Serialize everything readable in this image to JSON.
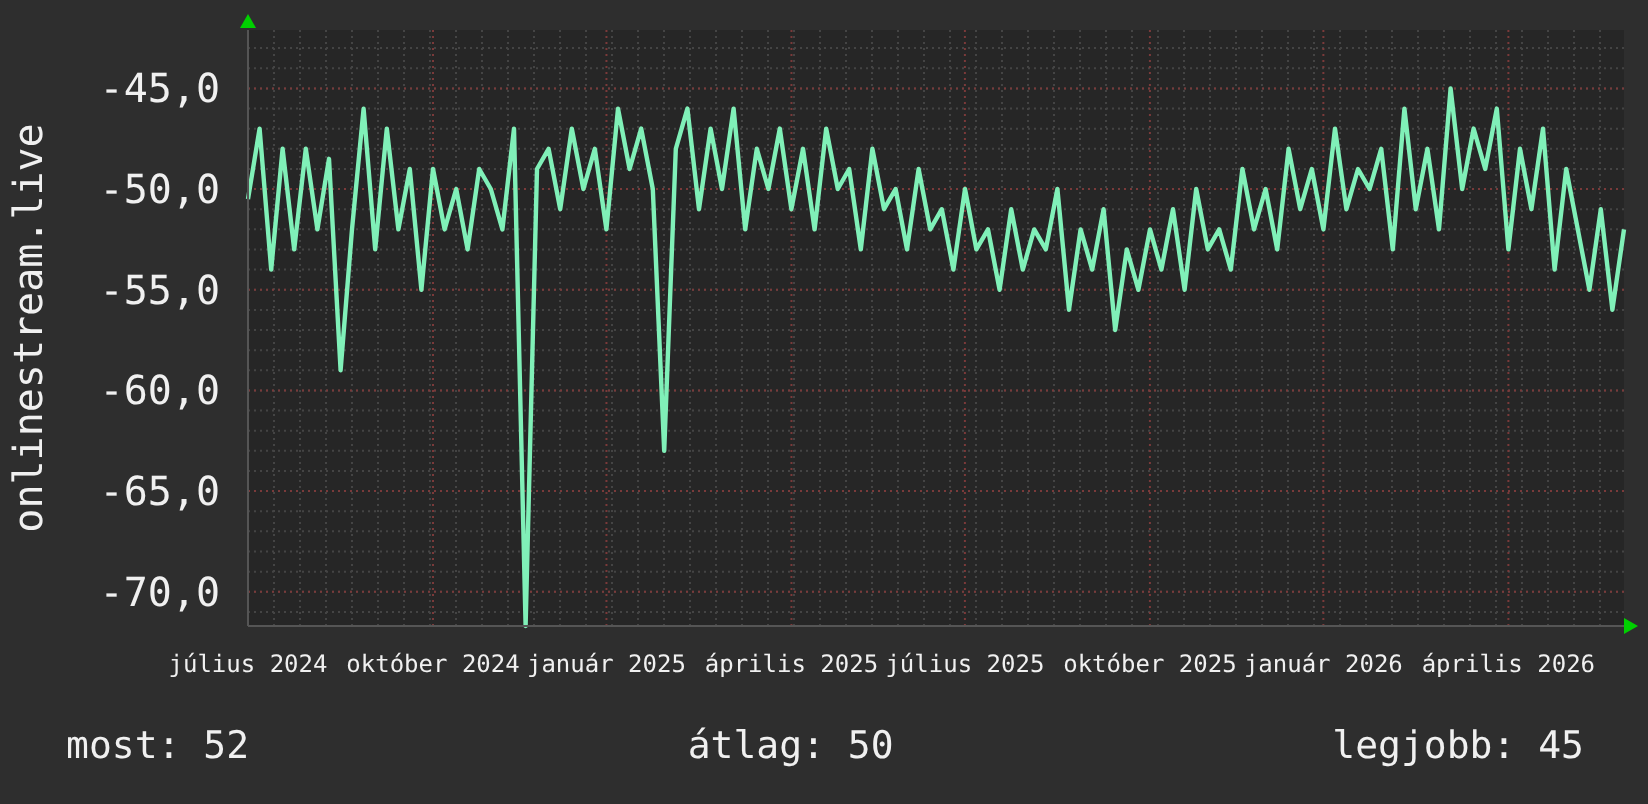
{
  "graph": {
    "chart_data": {
      "type": "line",
      "grid": true,
      "categories": [
        "július 2024",
        null,
        null,
        null,
        null,
        null,
        null,
        null,
        null,
        null,
        null,
        null,
        null,
        null,
        null,
        null,
        "október 2024",
        null,
        null,
        null,
        null,
        null,
        null,
        null,
        null,
        null,
        null,
        null,
        null,
        null,
        null,
        "január 2025",
        null,
        null,
        null,
        null,
        null,
        null,
        null,
        null,
        null,
        null,
        null,
        null,
        null,
        null,
        null,
        "április 2025",
        null,
        null,
        null,
        null,
        null,
        null,
        null,
        null,
        null,
        null,
        null,
        null,
        null,
        null,
        "július 2025",
        null,
        null,
        null,
        null,
        null,
        null,
        null,
        null,
        null,
        null,
        null,
        null,
        null,
        null,
        null,
        "október 2025",
        null,
        null,
        null,
        null,
        null,
        null,
        null,
        null,
        null,
        null,
        null,
        null,
        null,
        null,
        "január 2026",
        null,
        null,
        null,
        null,
        null,
        null,
        null,
        null,
        null,
        null,
        null,
        null,
        null,
        null,
        null,
        "április 2026",
        null,
        null,
        null,
        null,
        null,
        null,
        null,
        null,
        null,
        null
      ],
      "series": [
        {
          "name": "onlinestream.live",
          "color": "#80f0b8",
          "values": [
            -50.5,
            -47,
            -54,
            -48,
            -53,
            -48,
            -52,
            -48.5,
            -59,
            -52,
            -46,
            -53,
            -47,
            -52,
            -49,
            -55,
            -49,
            -52,
            -50,
            -53,
            -49,
            -50,
            -52,
            -47,
            -71.7,
            -49,
            -48,
            -51,
            -47,
            -50,
            -48,
            -52,
            -46,
            -49,
            -47,
            -50,
            -63,
            -48,
            -46,
            -51,
            -47,
            -50,
            -46,
            -52,
            -48,
            -50,
            -47,
            -51,
            -48,
            -52,
            -47,
            -50,
            -49,
            -53,
            -48,
            -51,
            -50,
            -53,
            -49,
            -52,
            -51,
            -54,
            -50,
            -53,
            -52,
            -55,
            -51,
            -54,
            -52,
            -53,
            -50,
            -56,
            -52,
            -54,
            -51,
            -57,
            -53,
            -55,
            -52,
            -54,
            -51,
            -55,
            -50,
            -53,
            -52,
            -54,
            -49,
            -52,
            -50,
            -53,
            -48,
            -51,
            -49,
            -52,
            -47,
            -51,
            -49,
            -50,
            -48,
            -53,
            -46,
            -51,
            -48,
            -52,
            -45,
            -50,
            -47,
            -49,
            -46,
            -53,
            -48,
            -51,
            -47,
            -54,
            -49,
            -52,
            -55,
            -51,
            -56,
            -52
          ]
        }
      ],
      "ylim": [
        -71.7,
        -42.1
      ],
      "yticks": [
        {
          "value": -45,
          "label": "-45,0"
        },
        {
          "value": -50,
          "label": "-50,0"
        },
        {
          "value": -55,
          "label": "-55,0"
        },
        {
          "value": -60,
          "label": "-60,0"
        },
        {
          "value": -65,
          "label": "-65,0"
        },
        {
          "value": -70,
          "label": "-70,0"
        }
      ]
    }
  },
  "legend": [
    "most: 52",
    "átlag: 50",
    "legjobb: 45"
  ]
}
